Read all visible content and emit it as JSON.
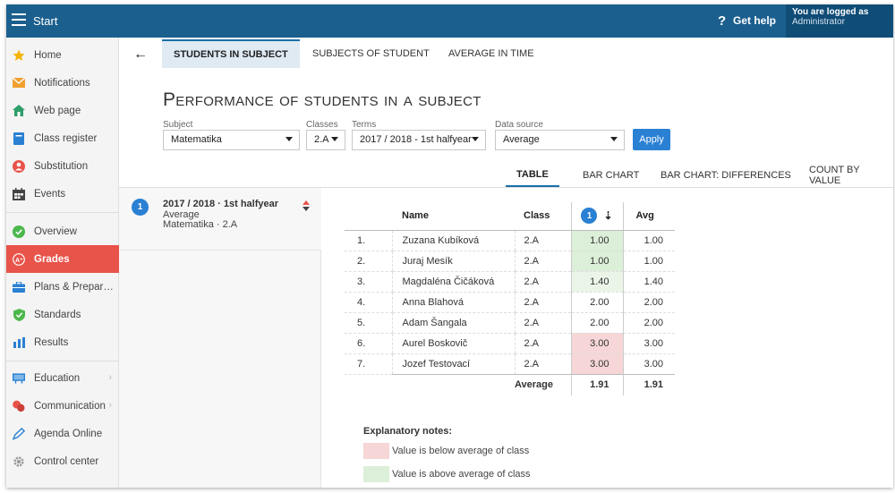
{
  "app": {
    "title": "Start",
    "help_label": "Get help",
    "help_icon_text": "?",
    "login_line1": "You are logged as",
    "login_line2": "Administrator"
  },
  "sidebar": {
    "items": [
      {
        "label": "Home",
        "icon": "star-icon"
      },
      {
        "label": "Notifications",
        "icon": "envelope-icon"
      },
      {
        "label": "Web page",
        "icon": "house-icon"
      },
      {
        "label": "Class register",
        "icon": "book-icon"
      },
      {
        "label": "Substitution",
        "icon": "person-icon"
      },
      {
        "label": "Events",
        "icon": "calendar-icon"
      },
      {
        "label": "Overview",
        "icon": "check-circle-icon"
      },
      {
        "label": "Grades",
        "icon": "grades-icon",
        "active": true
      },
      {
        "label": "Plans & Prepar…",
        "icon": "briefcase-icon"
      },
      {
        "label": "Standards",
        "icon": "shield-check-icon"
      },
      {
        "label": "Results",
        "icon": "bar-chart-icon"
      },
      {
        "label": "Education",
        "icon": "board-icon",
        "has_submenu": true
      },
      {
        "label": "Communication",
        "icon": "chat-icon",
        "has_submenu": true
      },
      {
        "label": "Agenda Online",
        "icon": "pen-icon"
      },
      {
        "label": "Control center",
        "icon": "gear-icon"
      }
    ]
  },
  "tabs": [
    {
      "label": "STUDENTS IN SUBJECT",
      "active": true
    },
    {
      "label": "SUBJECTS OF STUDENT"
    },
    {
      "label": "AVERAGE IN TIME"
    }
  ],
  "page": {
    "title": "Performance of students in a subject"
  },
  "filters": {
    "subject": {
      "label": "Subject",
      "value": "Matematika"
    },
    "classes": {
      "label": "Classes",
      "value": "2.A"
    },
    "terms": {
      "label": "Terms",
      "value": "2017 / 2018 - 1st halfyear"
    },
    "data_source": {
      "label": "Data source",
      "value": "Average"
    },
    "apply_label": "Apply"
  },
  "view_tabs": [
    {
      "label": "TABLE",
      "active": true
    },
    {
      "label": "BAR CHART"
    },
    {
      "label": "BAR CHART: DIFFERENCES"
    },
    {
      "label": "COUNT BY VALUE"
    }
  ],
  "term_item": {
    "number": "1",
    "title": "2017 / 2018 · 1st halfyear",
    "line1": "Average",
    "line2": "Matematika · 2.A"
  },
  "table": {
    "headers": {
      "name": "Name",
      "class": "Class",
      "term_badge": "1",
      "avg": "Avg"
    },
    "rows": [
      {
        "num": "1.",
        "name": "Zuzana Kubíková",
        "class": "2.A",
        "value": "1.00",
        "avg": "1.00",
        "status": "above"
      },
      {
        "num": "2.",
        "name": "Juraj Mesík",
        "class": "2.A",
        "value": "1.00",
        "avg": "1.00",
        "status": "above"
      },
      {
        "num": "3.",
        "name": "Magdaléna Čičáková",
        "class": "2.A",
        "value": "1.40",
        "avg": "1.40",
        "status": "above-light"
      },
      {
        "num": "4.",
        "name": "Anna Blahová",
        "class": "2.A",
        "value": "2.00",
        "avg": "2.00",
        "status": "none"
      },
      {
        "num": "5.",
        "name": "Adam Šangala",
        "class": "2.A",
        "value": "2.00",
        "avg": "2.00",
        "status": "none"
      },
      {
        "num": "6.",
        "name": "Aurel Boskovič",
        "class": "2.A",
        "value": "3.00",
        "avg": "3.00",
        "status": "below"
      },
      {
        "num": "7.",
        "name": "Jozef Testovací",
        "class": "2.A",
        "value": "3.00",
        "avg": "3.00",
        "status": "below"
      }
    ],
    "footer": {
      "label": "Average",
      "value": "1.91",
      "avg": "1.91"
    }
  },
  "notes": {
    "title": "Explanatory notes:",
    "below": "Value is below average of class",
    "above": "Value is above average of class"
  },
  "colors": {
    "topbar": "#1b5f8e",
    "accent": "#2a80d3",
    "active_nav": "#e8534a",
    "below": "#f6d6d6",
    "above": "#dcefd8"
  }
}
